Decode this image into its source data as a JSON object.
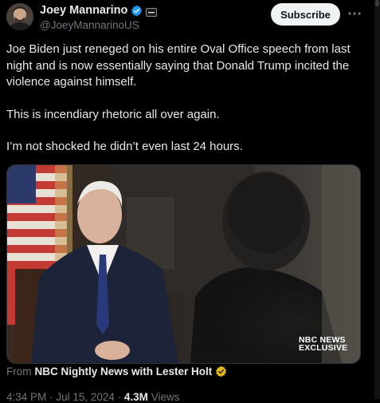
{
  "author": {
    "name": "Joey Mannarino",
    "handle": "@JoeyMannarinoUS"
  },
  "actions": {
    "subscribe_label": "Subscribe"
  },
  "tweet": {
    "paragraphs": [
      "Joe Biden just reneged on his entire Oval Office speech from last night and is now essentially saying that Donald Trump incited the violence against himself.",
      "This is incendiary rhetoric all over again.",
      "I’m not shocked he didn’t even last 24 hours."
    ]
  },
  "media": {
    "watermark_line1": "NBC NEWS",
    "watermark_line2": "EXCLUSIVE",
    "source_prefix": "From",
    "source_name": "NBC Nightly News with Lester Holt"
  },
  "meta": {
    "time": "4:34 PM",
    "date": "Jul 15, 2024",
    "separator": "·",
    "views_count": "4.3M",
    "views_label": "Views"
  },
  "colors": {
    "background": "#000000",
    "verified_blue": "#1d9bf0",
    "gold_badge": "#e2b719",
    "muted_text": "#71767b"
  },
  "icons": {
    "verified": "verified-check-icon",
    "affiliate": "affiliate-badge-icon",
    "more": "more-dots-icon",
    "gold": "gold-verified-icon"
  }
}
